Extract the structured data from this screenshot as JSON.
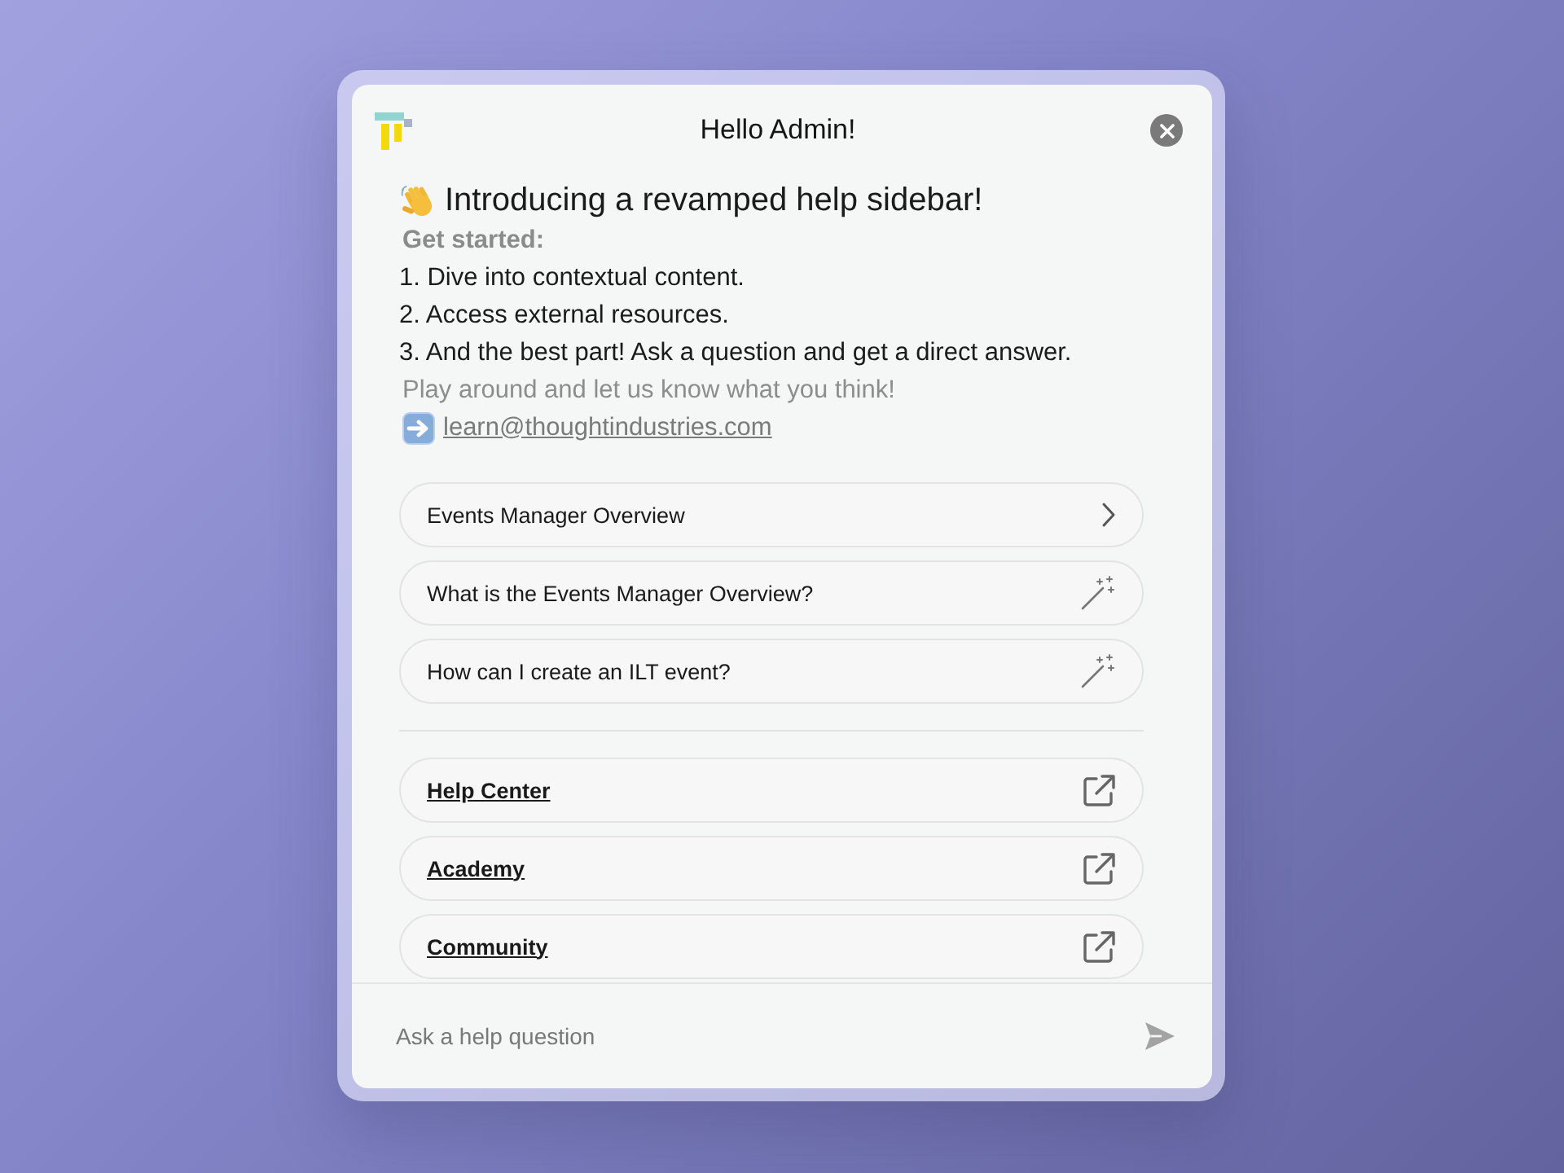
{
  "header": {
    "title": "Hello Admin!"
  },
  "intro": {
    "heading": "Introducing a revamped help sidebar!",
    "label": "Get started:",
    "steps": [
      "1. Dive into contextual content.",
      "2. Access external resources.",
      "3. And the best part! Ask a question and get a direct answer."
    ],
    "note": "Play around and let us know what you think!",
    "email": "learn@thoughtindustries.com"
  },
  "suggestions": [
    {
      "kind": "topic",
      "label": "Events Manager Overview"
    },
    {
      "kind": "question",
      "label": "What is the Events Manager Overview?"
    },
    {
      "kind": "question",
      "label": "How can I create an ILT event?"
    }
  ],
  "resources": [
    {
      "label": "Help Center"
    },
    {
      "label": "Academy"
    },
    {
      "label": "Community"
    }
  ],
  "composer": {
    "placeholder": "Ask a help question"
  }
}
